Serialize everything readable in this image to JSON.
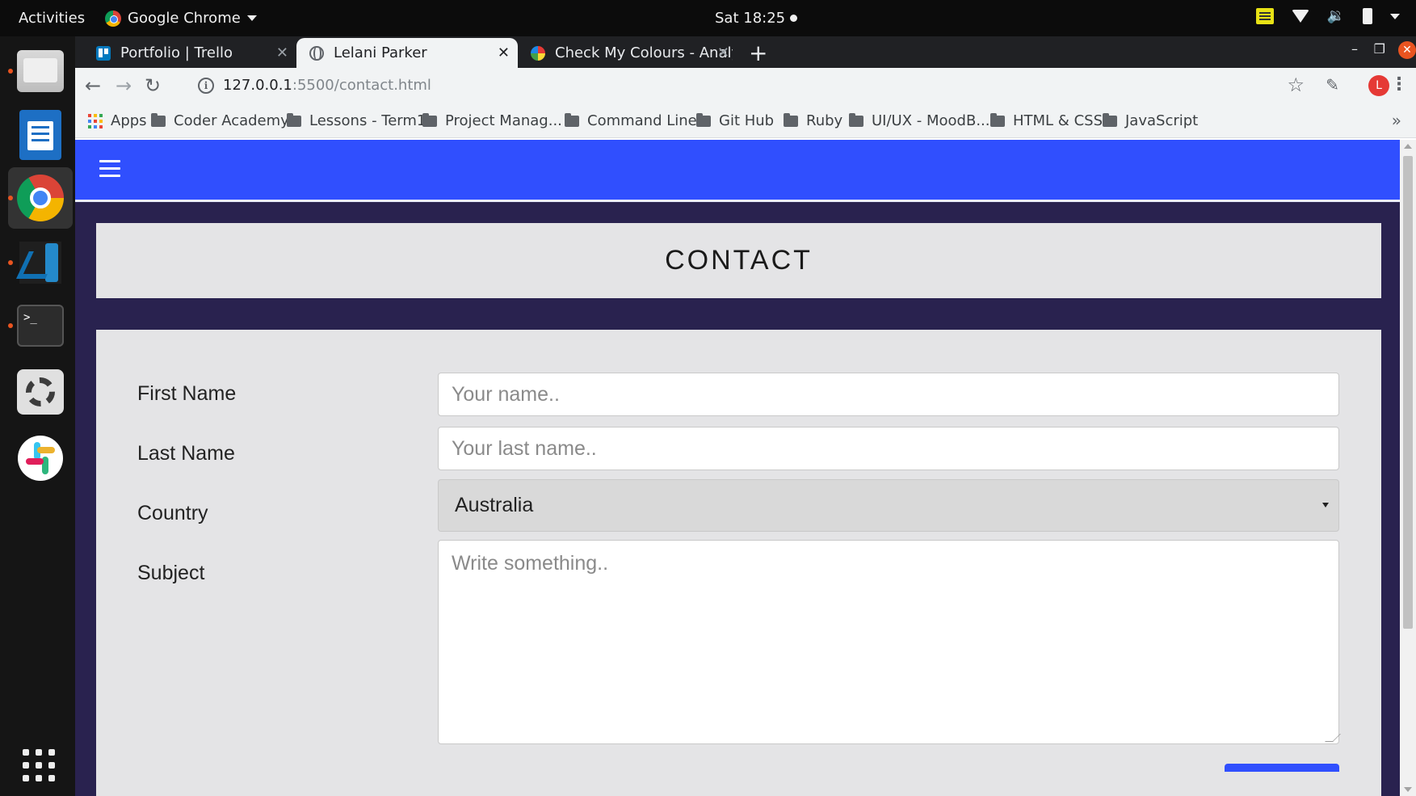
{
  "system_bar": {
    "activities": "Activities",
    "app_name": "Google Chrome",
    "clock": "Sat 18:25"
  },
  "dock": {
    "apps": [
      "files",
      "libreoffice-writer",
      "google-chrome",
      "vscode",
      "terminal",
      "settings",
      "slack"
    ],
    "terminal_prompt": ">_"
  },
  "browser": {
    "tabs": [
      {
        "title": "Portfolio | Trello",
        "favicon": "trello-icon",
        "active": false
      },
      {
        "title": "Lelani Parker",
        "favicon": "globe-icon",
        "active": true
      },
      {
        "title": "Check My Colours - Analyse",
        "favicon": "checkmycolours-icon",
        "active": false
      }
    ],
    "new_tab": "+",
    "url": {
      "host": "127.0.0.1",
      "rest": ":5500/contact.html"
    },
    "profile_initial": "L",
    "bookmarks": [
      {
        "label": "Apps",
        "icon": "apps-grid-icon"
      },
      {
        "label": "Coder Academy",
        "icon": "folder-icon"
      },
      {
        "label": "Lessons - Term1",
        "icon": "folder-icon"
      },
      {
        "label": "Project Manag...",
        "icon": "folder-icon"
      },
      {
        "label": "Command Line",
        "icon": "folder-icon"
      },
      {
        "label": "Git Hub",
        "icon": "folder-icon"
      },
      {
        "label": "Ruby",
        "icon": "folder-icon"
      },
      {
        "label": "UI/UX - MoodB...",
        "icon": "folder-icon"
      },
      {
        "label": "HTML & CSS",
        "icon": "folder-icon"
      },
      {
        "label": "JavaScript",
        "icon": "folder-icon"
      }
    ],
    "more_bookmarks": "»"
  },
  "page": {
    "colors": {
      "navbar": "#304ffe",
      "background": "#29224f",
      "panel": "#e4e4e6"
    },
    "heading": "CONTACT",
    "form": {
      "first_name": {
        "label": "First Name",
        "placeholder": "Your name.."
      },
      "last_name": {
        "label": "Last Name",
        "placeholder": "Your last name.."
      },
      "country": {
        "label": "Country",
        "selected": "Australia"
      },
      "subject": {
        "label": "Subject",
        "placeholder": "Write something.."
      }
    }
  }
}
